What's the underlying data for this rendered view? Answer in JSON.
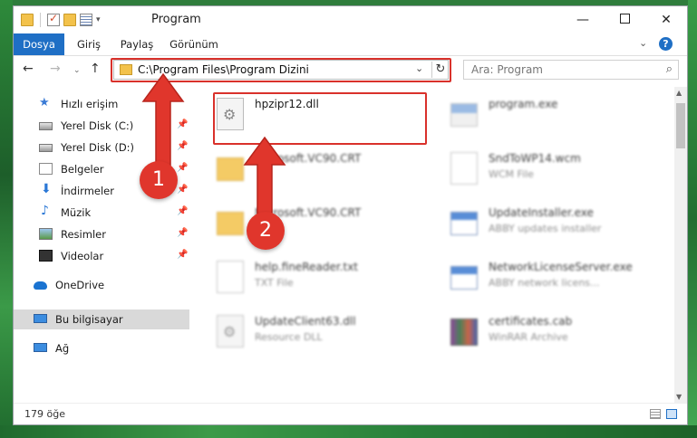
{
  "window": {
    "title": "Program"
  },
  "ribbon": {
    "tabs": [
      "Dosya",
      "Giriş",
      "Paylaş",
      "Görünüm"
    ],
    "help": "?"
  },
  "navigation": {
    "address": "C:\\Program Files\\Program Dizini",
    "search_placeholder": "Ara: Program"
  },
  "sidebar": {
    "items": [
      {
        "label": "Hızlı erişim",
        "icon": "star-icon"
      },
      {
        "label": "Yerel Disk (C:)",
        "icon": "disk-icon",
        "pinned": true
      },
      {
        "label": "Yerel Disk (D:)",
        "icon": "disk-icon",
        "pinned": true
      },
      {
        "label": "Belgeler",
        "icon": "documents-icon",
        "pinned": true
      },
      {
        "label": "İndirmeler",
        "icon": "download-icon",
        "pinned": true
      },
      {
        "label": "Müzik",
        "icon": "music-icon",
        "pinned": true
      },
      {
        "label": "Resimler",
        "icon": "pictures-icon",
        "pinned": true
      },
      {
        "label": "Videolar",
        "icon": "videos-icon",
        "pinned": true
      },
      {
        "label": "OneDrive",
        "icon": "onedrive-icon"
      },
      {
        "label": "Bu bilgisayar",
        "icon": "computer-icon",
        "selected": true
      },
      {
        "label": "Ağ",
        "icon": "network-icon"
      }
    ]
  },
  "files": [
    {
      "name": "hpzipr12.dll",
      "sub": "",
      "type": "dll"
    },
    {
      "name": "program.exe",
      "sub": "",
      "type": "prog"
    },
    {
      "name": "Microsoft.VC90.CRT",
      "sub": "",
      "type": "folder"
    },
    {
      "name": "SndToWP14.wcm",
      "sub": "WCM File",
      "type": "txt"
    },
    {
      "name": "Microsoft.VC90.CRT",
      "sub": "",
      "type": "folder"
    },
    {
      "name": "UpdateInstaller.exe",
      "sub": "ABBY updates installer",
      "type": "exe"
    },
    {
      "name": "help.fineReader.txt",
      "sub": "TXT File",
      "type": "txt"
    },
    {
      "name": "NetworkLicenseServer.exe",
      "sub": "ABBY network licens...",
      "type": "exe"
    },
    {
      "name": "UpdateClient63.dll",
      "sub": "Resource DLL",
      "type": "dll"
    },
    {
      "name": "certificates.cab",
      "sub": "WinRAR Archive",
      "type": "cab"
    }
  ],
  "status": {
    "count": "179 öğe"
  },
  "annotations": {
    "badge1": "1",
    "badge2": "2"
  },
  "colors": {
    "accent": "#1f6fc5",
    "highlight": "#d9312b",
    "badge": "#e0362c"
  }
}
